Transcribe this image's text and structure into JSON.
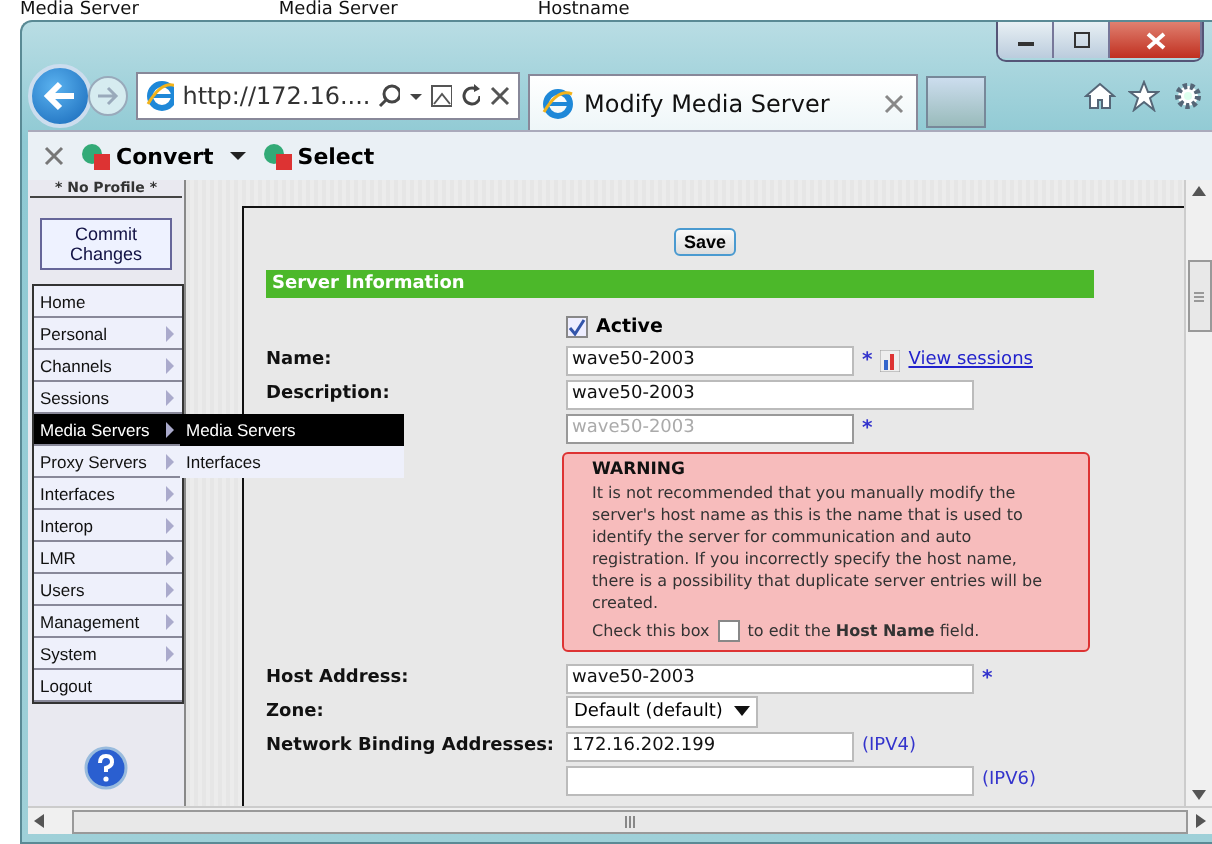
{
  "background_titles": [
    "Media Server",
    "Media Server",
    "Hostname"
  ],
  "browser": {
    "address": "http://172.16....",
    "tab_title": "Modify Media Server"
  },
  "command_bar": {
    "items": [
      "Convert",
      "Select"
    ]
  },
  "sidebar": {
    "profile": "* No Profile *",
    "commit_button": "Commit Changes",
    "items": [
      {
        "label": "Home",
        "submenu": false,
        "selected": false
      },
      {
        "label": "Personal",
        "submenu": true,
        "selected": false
      },
      {
        "label": "Channels",
        "submenu": true,
        "selected": false
      },
      {
        "label": "Sessions",
        "submenu": true,
        "selected": false
      },
      {
        "label": "Media Servers",
        "submenu": true,
        "selected": true
      },
      {
        "label": "Proxy Servers",
        "submenu": true,
        "selected": false
      },
      {
        "label": "Interfaces",
        "submenu": true,
        "selected": false
      },
      {
        "label": "Interop",
        "submenu": true,
        "selected": false
      },
      {
        "label": "LMR",
        "submenu": true,
        "selected": false
      },
      {
        "label": "Users",
        "submenu": true,
        "selected": false
      },
      {
        "label": "Management",
        "submenu": true,
        "selected": false
      },
      {
        "label": "System",
        "submenu": true,
        "selected": false
      },
      {
        "label": "Logout",
        "submenu": false,
        "selected": false
      }
    ],
    "flyout": [
      {
        "label": "Media Servers",
        "selected": true
      },
      {
        "label": "Interfaces",
        "selected": false
      }
    ]
  },
  "form": {
    "save_button": "Save",
    "section_title": "Server Information",
    "active": {
      "label": "Active",
      "checked": true
    },
    "rows_top": [
      {
        "label": "Name:",
        "value": "wave50-2003",
        "required_mark": "*",
        "link": "View sessions",
        "disabled": false,
        "wide": false
      },
      {
        "label": "Description:",
        "value": "wave50-2003",
        "disabled": false,
        "wide": true
      },
      {
        "value": "wave50-2003",
        "required_mark": "*",
        "disabled": true,
        "wide": false
      }
    ],
    "warning": {
      "title": "WARNING",
      "text": "It is not recommended that you manually modify the server's host name as this is the name that is used to identify the server for communication and auto registration. If you incorrectly specify the host name, there is a possibility that duplicate server entries will be created.",
      "check_before": "Check this box",
      "checked": false,
      "check_after": "to edit the **Host Name** field."
    },
    "rows_bottom": [
      {
        "kind": "text",
        "label": "Host Address:",
        "value": "wave50-2003",
        "required_mark": "*",
        "disabled": false,
        "wide": true
      },
      {
        "kind": "select",
        "label": "Zone:",
        "value": "Default (default)"
      },
      {
        "kind": "text",
        "label": "Network Binding Addresses:",
        "value": "172.16.202.199",
        "disabled": false,
        "wide": false,
        "note": "(IPV4)"
      },
      {
        "kind": "text",
        "disabled": false,
        "wide": true,
        "note": "(IPV6)"
      }
    ]
  }
}
